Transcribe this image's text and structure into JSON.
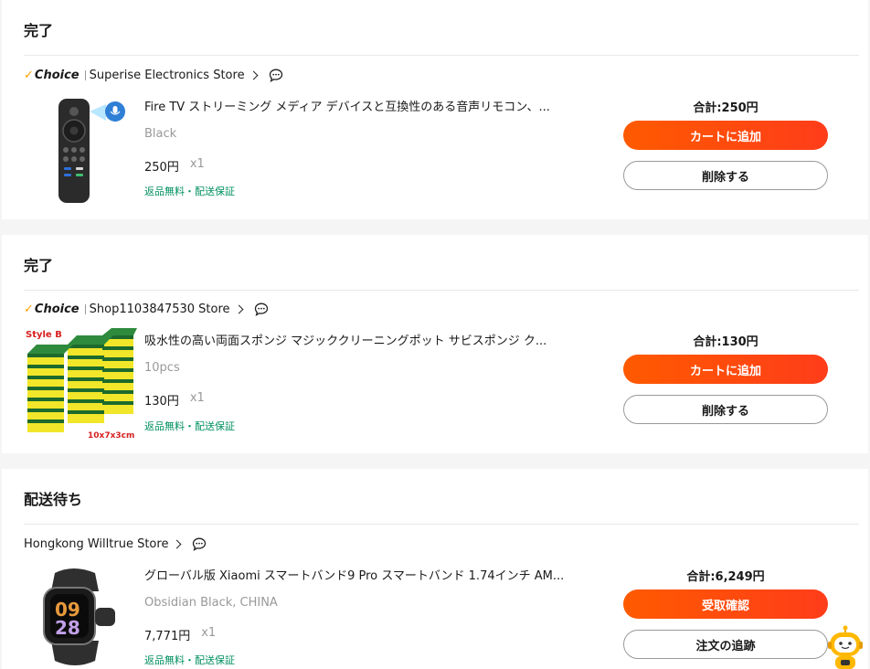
{
  "orders": [
    {
      "status": "完了",
      "choice_label": "Choice",
      "store_name": "Superise Electronics Store",
      "product_title": "Fire TV ストリーミング メディア デバイスと互換性のある音声リモコン、...",
      "variant": "Black",
      "price": "250円",
      "qty": "x1",
      "badge": "返品無料・配送保証",
      "total": "合計:250円",
      "primary_label": "カートに追加",
      "secondary_label": "削除する",
      "thumb_icon": "remote-control-icon"
    },
    {
      "status": "完了",
      "choice_label": "Choice",
      "store_name": "Shop1103847530 Store",
      "product_title": "吸水性の高い両面スポンジ マジッククリーニングポット サビスポンジ ク...",
      "variant": "10pcs",
      "price": "130円",
      "qty": "x1",
      "badge": "返品無料・配送保証",
      "total": "合計:130円",
      "primary_label": "カートに追加",
      "secondary_label": "削除する",
      "thumb_icon": "sponge-stack-icon",
      "thumb_text_top": "Style B",
      "thumb_text_bottom": "10x7x3cm"
    },
    {
      "status": "配送待ち",
      "store_name": "Hongkong Willtrue Store",
      "product_title": "グローバル版 Xiaomi スマートバンド9 Pro スマートバンド 1.74インチ AM...",
      "variant": "Obsidian Black, CHINA",
      "price": "7,771円",
      "qty": "x1",
      "badge": "返品無料・配送保証",
      "total": "合計:6,249円",
      "primary_label": "受取確認",
      "secondary_label": "注文の追跡",
      "thumb_icon": "smart-band-icon"
    }
  ],
  "colors": {
    "accent": "#ff4f0a",
    "badge_green": "#00905f",
    "choice_check": "#ff9f00"
  },
  "assistant_icon": "robot-assistant-icon"
}
